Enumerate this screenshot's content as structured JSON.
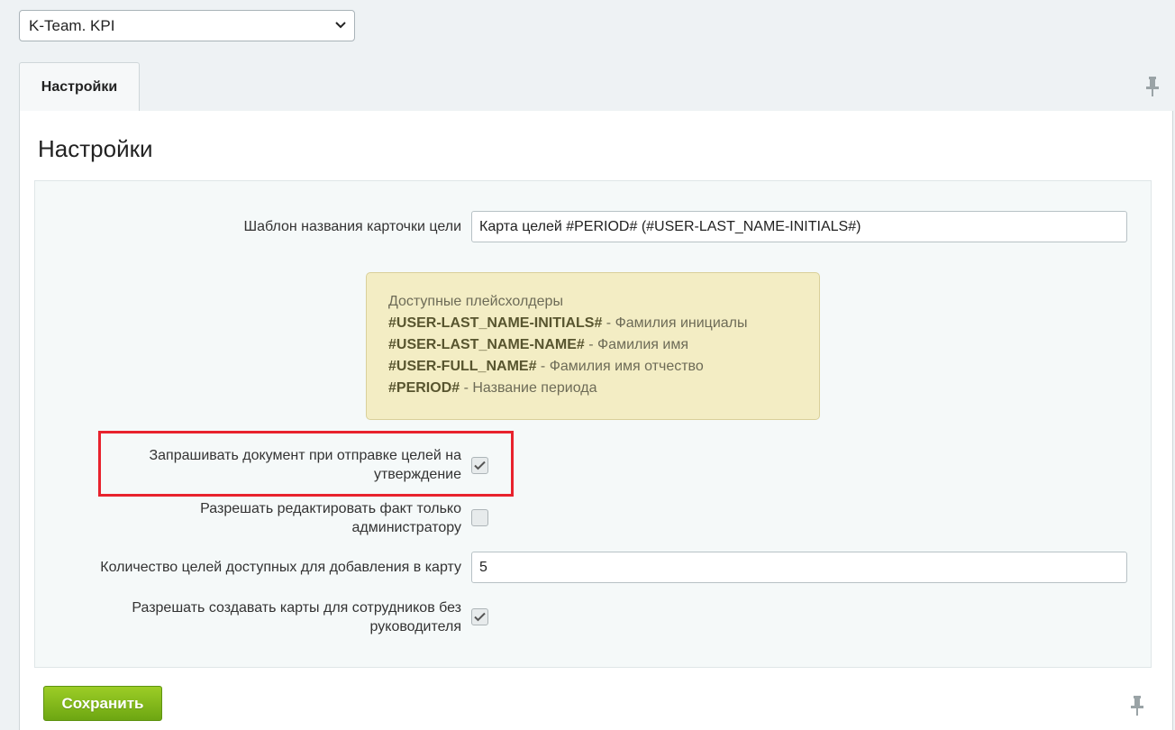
{
  "site_select": {
    "value": "K-Team. KPI"
  },
  "tabs": [
    {
      "label": "Настройки"
    }
  ],
  "page": {
    "title": "Настройки"
  },
  "form": {
    "template_field": {
      "label": "Шаблон названия карточки цели",
      "value": "Карта целей #PERIOD# (#USER-LAST_NAME-INITIALS#)"
    },
    "hint": {
      "title": "Доступные плейсхолдеры",
      "items": [
        {
          "key": "#USER-LAST_NAME-INITIALS#",
          "desc": " - Фамилия инициалы"
        },
        {
          "key": "#USER-LAST_NAME-NAME#",
          "desc": " - Фамилия имя"
        },
        {
          "key": "#USER-FULL_NAME#",
          "desc": " - Фамилия имя отчество"
        },
        {
          "key": "#PERIOD#",
          "desc": " - Название периода"
        }
      ]
    },
    "request_document": {
      "label": "Запрашивать документ при отправке целей на утверждение",
      "checked": true
    },
    "admin_edit_fact": {
      "label": "Разрешать редактировать факт только администратору",
      "checked": false
    },
    "goals_count": {
      "label": "Количество целей доступных для добавления в карту",
      "value": "5"
    },
    "allow_no_manager": {
      "label": "Разрешать создавать карты для сотрудников без руководителя",
      "checked": true
    }
  },
  "actions": {
    "save_label": "Сохранить"
  },
  "colors": {
    "highlight": "#e8222d",
    "save_button": "#7ab51d",
    "hint_bg": "#f3edc4"
  },
  "icons": [
    "chevron-down-icon",
    "pin-icon",
    "checkmark-icon"
  ]
}
